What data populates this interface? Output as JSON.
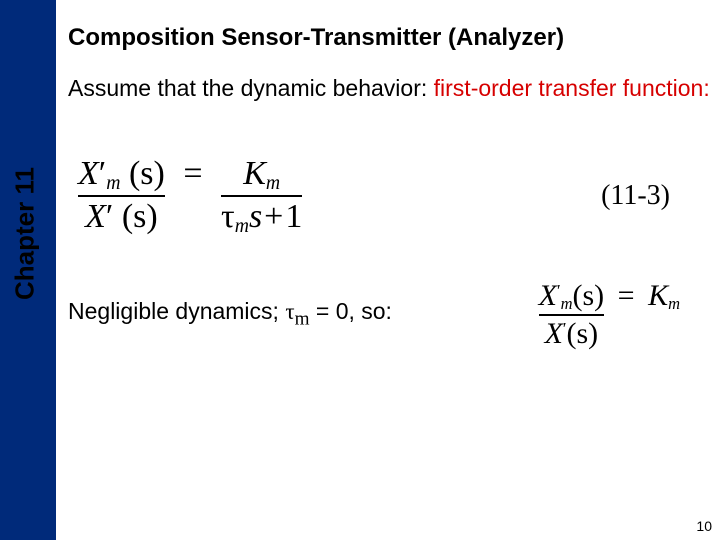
{
  "sidebar": {
    "chapter_label": "Chapter 11"
  },
  "title": "Composition Sensor-Transmitter (Analyzer)",
  "intro": {
    "pre": "Assume that the dynamic behavior:  ",
    "highlight": "first-order transfer function:",
    "post": ""
  },
  "equation1": {
    "lhs_num_var": "X",
    "lhs_num_prime": "′",
    "lhs_num_sub": "m",
    "lhs_num_arg": "(s)",
    "lhs_den_var": "X",
    "lhs_den_prime": "′",
    "lhs_den_arg": "(s)",
    "rhs_num_var": "K",
    "rhs_num_sub": "m",
    "rhs_den_tau": "τ",
    "rhs_den_sub": "m",
    "rhs_den_rest": "s",
    "rhs_den_plus": "+",
    "rhs_den_one": "1",
    "eq_sign": "=",
    "number": "(11-3)"
  },
  "negligible": {
    "text_pre": "Negligible dynamics; ",
    "tau": "τ",
    "tau_sub": "m",
    "text_post": " = 0, so:"
  },
  "equation2": {
    "lhs_num_var": "X",
    "lhs_num_sub": "m",
    "lhs_num_arg": "(s)",
    "lhs_den_var": "X",
    "lhs_den_arg": "(s)",
    "eq_sign": "=",
    "rhs_var": "K",
    "rhs_sub": "m",
    "prime": "′"
  },
  "page_number": "10"
}
